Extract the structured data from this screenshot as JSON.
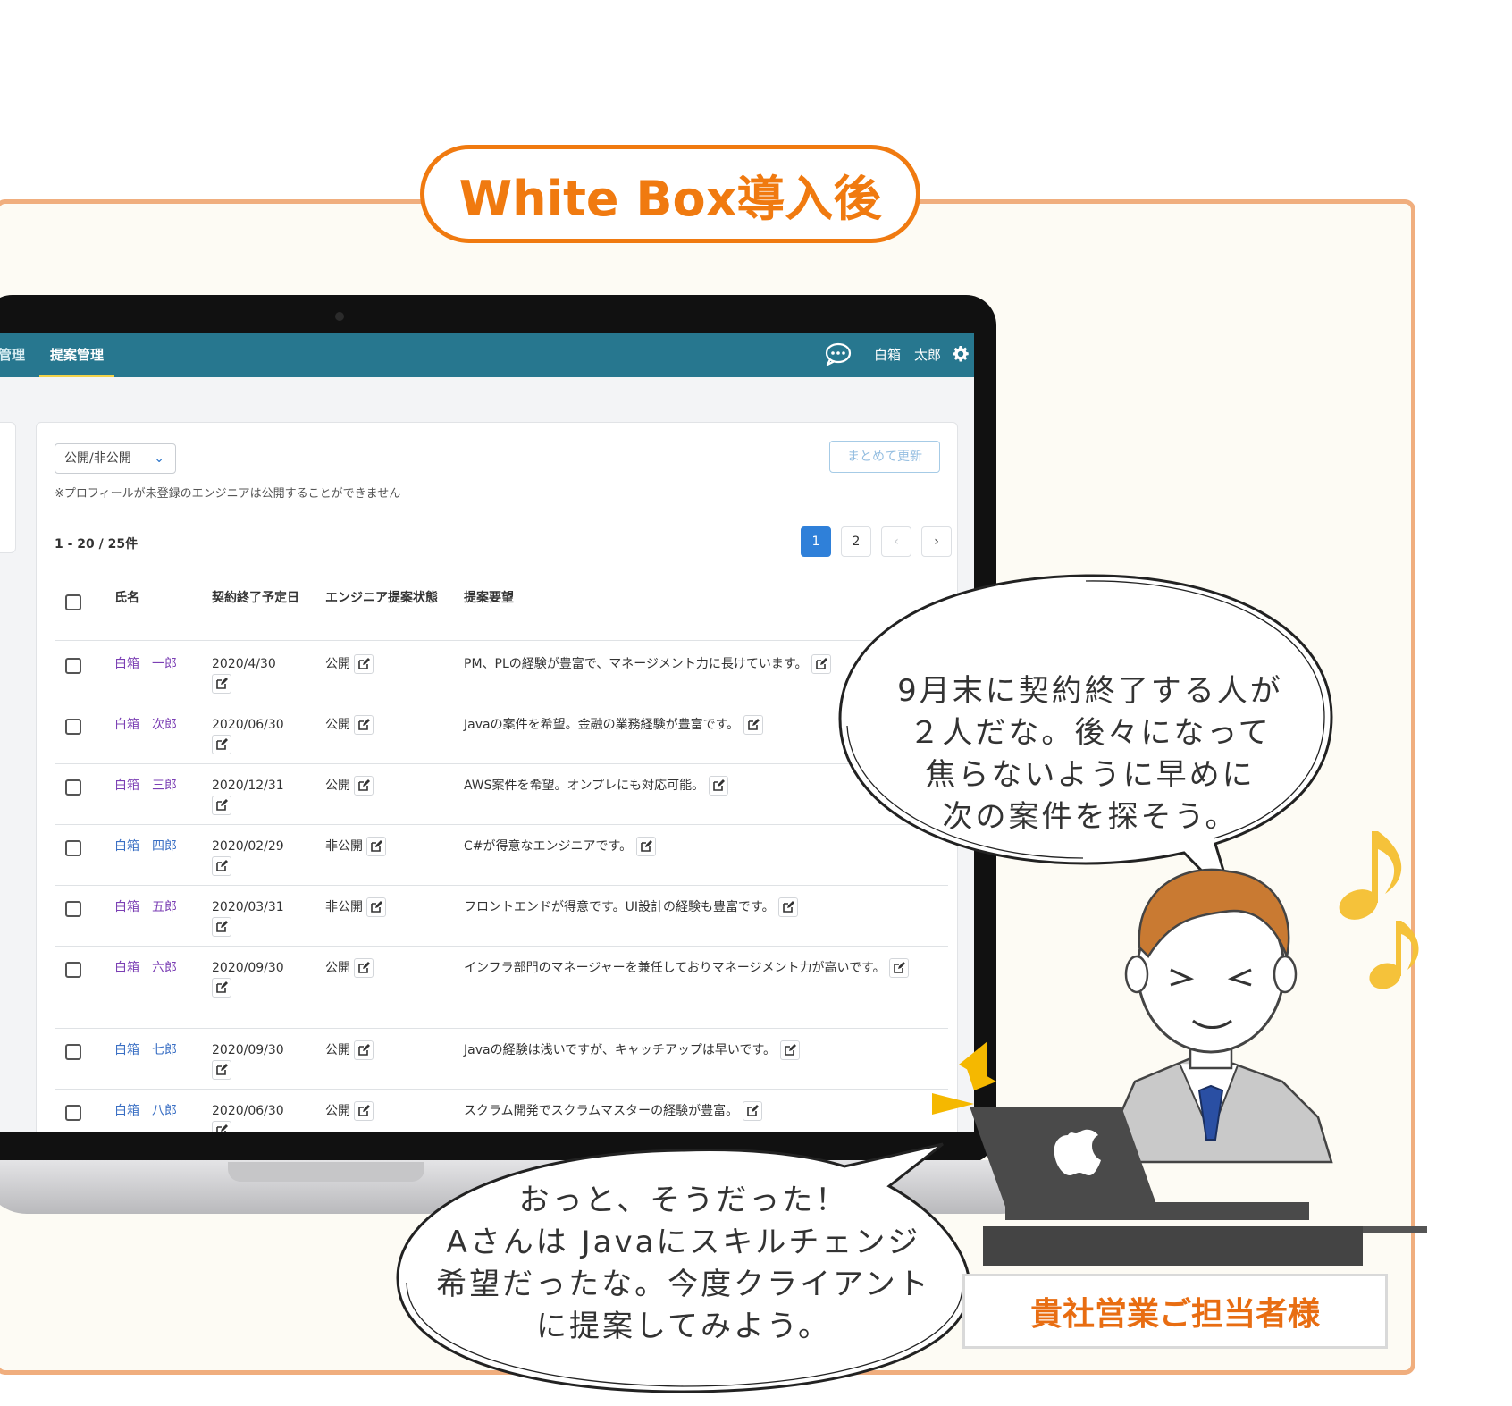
{
  "header_badge": "White Box導入後",
  "app": {
    "nav_tabs": [
      {
        "label": "管理"
      },
      {
        "label": "提案管理"
      }
    ],
    "user_name": "白箱　太郎",
    "filter_select": "公開/非公開",
    "bulk_update_button": "まとめて更新",
    "note": "※プロフィールが未登録のエンジニアは公開することができません",
    "result_count": "1 - 20 / 25件",
    "pagination": {
      "pages": [
        "1",
        "2"
      ],
      "prev": "‹",
      "next": "›",
      "current": "1"
    },
    "columns": [
      "氏名",
      "契約終了予定日",
      "エンジニア提案状態",
      "提案要望"
    ],
    "rows": [
      {
        "name": "白箱　一郎",
        "end_date": "2020/4/30",
        "status": "公開",
        "request": "PM、PLの経験が豊富で、マネージメント力に長けています。"
      },
      {
        "name": "白箱　次郎",
        "end_date": "2020/06/30",
        "status": "公開",
        "request": "Javaの案件を希望。金融の業務経験が豊富です。"
      },
      {
        "name": "白箱　三郎",
        "end_date": "2020/12/31",
        "status": "公開",
        "request": "AWS案件を希望。オンプレにも対応可能。"
      },
      {
        "name": "白箱　四郎",
        "end_date": "2020/02/29",
        "status": "非公開",
        "request": "C#が得意なエンジニアです。"
      },
      {
        "name": "白箱　五郎",
        "end_date": "2020/03/31",
        "status": "非公開",
        "request": "フロントエンドが得意です。UI設計の経験も豊富です。"
      },
      {
        "name": "白箱　六郎",
        "end_date": "2020/09/30",
        "status": "公開",
        "request": "インフラ部門のマネージャーを兼任しておりマネージメント力が高いです。"
      },
      {
        "name": "白箱　七郎",
        "end_date": "2020/09/30",
        "status": "公開",
        "request": "Javaの経験は浅いですが、キャッチアップは早いです。"
      },
      {
        "name": "白箱　八郎",
        "end_date": "2020/06/30",
        "status": "公開",
        "request": "スクラム開発でスクラムマスターの経験が豊富。"
      }
    ]
  },
  "bubble_right": [
    "9月末に契約終了する人が",
    "２人だな。後々になって",
    "焦らないように早めに",
    "次の案件を探そう。"
  ],
  "bubble_bottom": [
    "おっと、そうだった！",
    "Aさんは Javaにスキルチェンジ",
    "希望だったな。今度クライアント",
    "に提案してみよう。"
  ],
  "person_label": "貴社営業ご担当者様",
  "colors": {
    "accent_orange": "#f07a10",
    "frame": "#f0ae7e",
    "nav_bar": "#27778f",
    "active_page": "#2f80d9",
    "note_music": "#f5c23a"
  }
}
